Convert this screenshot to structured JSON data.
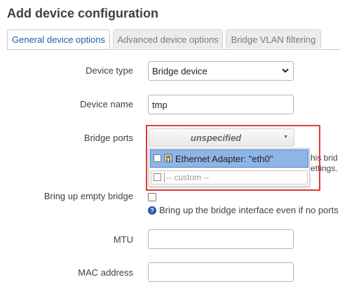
{
  "dialog": {
    "title": "Add device configuration"
  },
  "tabs": [
    {
      "label": "General device options",
      "active": true
    },
    {
      "label": "Advanced device options",
      "active": false
    },
    {
      "label": "Bridge VLAN filtering",
      "active": false
    }
  ],
  "form": {
    "device_type": {
      "label": "Device type",
      "value": "Bridge device"
    },
    "device_name": {
      "label": "Device name",
      "value": "tmp"
    },
    "bridge_ports": {
      "label": "Bridge ports",
      "value": "unspecified",
      "dropdown": {
        "options": [
          {
            "label": "Ethernet Adapter: \"eth0\"",
            "checked": false,
            "highlighted": true
          }
        ],
        "custom_placeholder": "-- custom --"
      },
      "description_partial_1": "his brid",
      "description_partial_2": "ettings."
    },
    "bring_up_empty_bridge": {
      "label": "Bring up empty bridge",
      "checked": false,
      "help": "Bring up the bridge interface even if no ports"
    },
    "mtu": {
      "label": "MTU",
      "value": ""
    },
    "mac_address": {
      "label": "MAC address",
      "value": ""
    }
  },
  "colors": {
    "accent": "#1f5ea8",
    "highlight_border": "#e03c3c",
    "selected_option": "#8eb5e8"
  },
  "icons": [
    "chevron-down-icon",
    "caret-down-icon",
    "network-adapter-icon",
    "help-icon"
  ]
}
